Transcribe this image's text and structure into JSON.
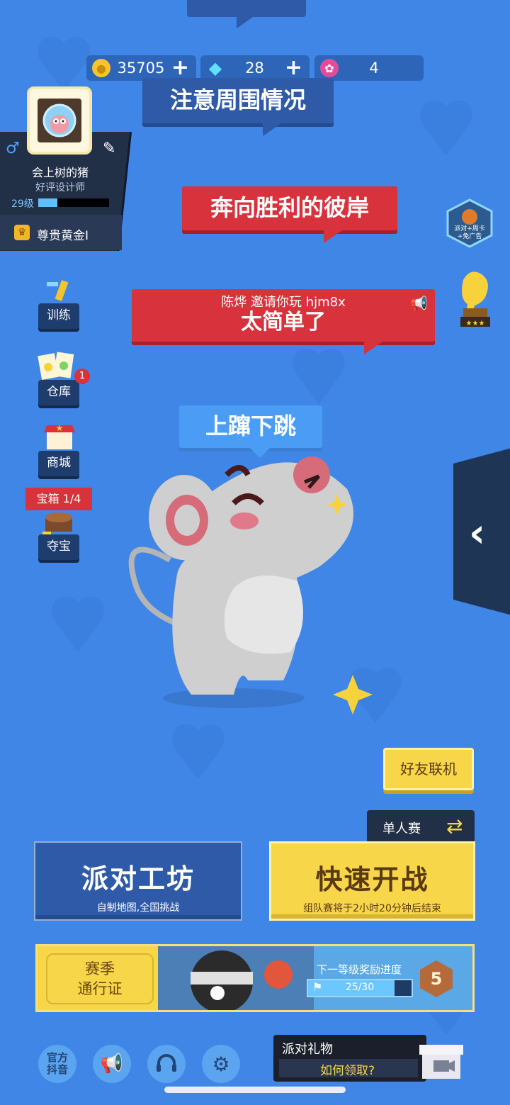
{
  "currency": {
    "coins": "35705",
    "gems": "28",
    "tokens": "4",
    "plus": "+"
  },
  "bubbles": {
    "notice": "注意周围情况",
    "victory": "奔向胜利的彼岸",
    "invite_line": "陈烨 邀请你玩 hjm8x",
    "invite_message": "太简单了",
    "action": "上蹿下跳"
  },
  "profile": {
    "name": "会上树的猪",
    "title": "好评设计师",
    "level": "29级",
    "rank": "尊贵黄金I",
    "level_progress": 0.27
  },
  "sidebar": {
    "training": "训练",
    "warehouse": "仓库",
    "warehouse_badge": "1",
    "shop": "商城",
    "treasure_tag": "宝箱 1/4",
    "treasure": "夺宝"
  },
  "right": {
    "promo_line1": "派对+周卡",
    "promo_line2": "+免广告"
  },
  "actions": {
    "friends": "好友联机",
    "mode": "单人赛",
    "workshop_title": "派对工坊",
    "workshop_sub": "自制地图,全国挑战",
    "quick_title": "快速开战",
    "quick_sub": "组队赛将于2小时20分钟后结束"
  },
  "pass": {
    "label_line1": "赛季",
    "label_line2": "通行证",
    "progress_label": "下一等级奖励进度",
    "progress": "25/30",
    "progress_value": 25,
    "progress_max": 30,
    "level": "5"
  },
  "footer": {
    "official_line1": "官方",
    "official_line2": "抖音",
    "gift_title": "派对礼物",
    "gift_sub": "如何领取?"
  },
  "colors": {
    "background": "#3f86e6",
    "red_bubble": "#d8323d",
    "navy": "#2e5aa8",
    "yellow": "#f7d64a"
  }
}
